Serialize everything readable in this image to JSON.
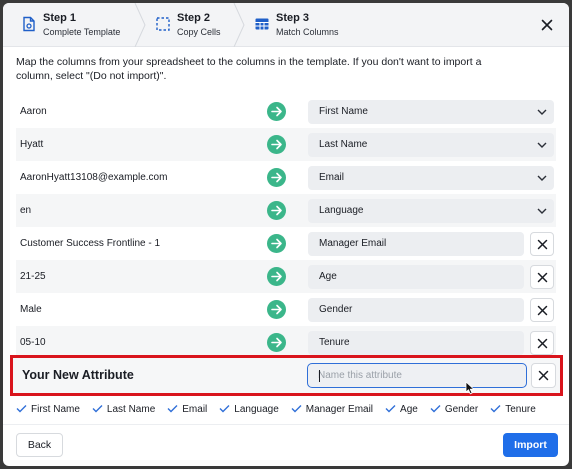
{
  "steps": [
    {
      "title": "Step 1",
      "subtitle": "Complete Template",
      "icon": "document-gear-icon"
    },
    {
      "title": "Step 2",
      "subtitle": "Copy Cells",
      "icon": "dashed-select-icon"
    },
    {
      "title": "Step 3",
      "subtitle": "Match Columns",
      "icon": "table-icon"
    }
  ],
  "instructions": "Map the columns from your spreadsheet to the columns in the template. If you don't want to import a column, select \"(Do not import)\".",
  "mappings": [
    {
      "source": "Aaron",
      "target": "First Name"
    },
    {
      "source": "Hyatt",
      "target": "Last Name"
    },
    {
      "source": "AaronHyatt13108@example.com",
      "target": "Email"
    },
    {
      "source": "en",
      "target": "Language"
    },
    {
      "source": "Customer Success Frontline - 1",
      "target": "Manager Email"
    },
    {
      "source": "21-25",
      "target": "Age"
    },
    {
      "source": "Male",
      "target": "Gender"
    },
    {
      "source": "05-10",
      "target": "Tenure"
    }
  ],
  "new_attribute": {
    "label": "Your New Attribute",
    "placeholder": "Name this attribute",
    "value": ""
  },
  "summary": [
    "First Name",
    "Last Name",
    "Email",
    "Language",
    "Manager Email",
    "Age",
    "Gender",
    "Tenure"
  ],
  "footer": {
    "back_label": "Back",
    "import_label": "Import"
  },
  "colors": {
    "accent": "#1f6ee9",
    "arrow": "#3bb68a",
    "highlight": "#d9141c"
  }
}
